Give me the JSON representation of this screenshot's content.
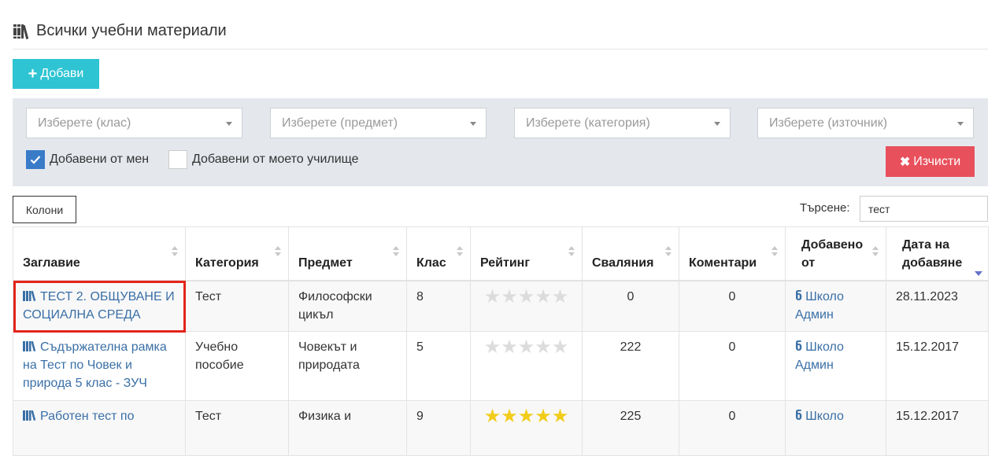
{
  "page": {
    "title": "Всички учебни материали",
    "add_label": "Добави"
  },
  "filters": {
    "class_placeholder": "Изберете (клас)",
    "subject_placeholder": "Изберете (предмет)",
    "category_placeholder": "Изберете (категория)",
    "source_placeholder": "Изберете (източник)",
    "added_by_me_label": "Добавени от мен",
    "added_by_me_checked": true,
    "added_by_school_label": "Добавени от моето училище",
    "added_by_school_checked": false,
    "clear_label": "Изчисти"
  },
  "toolbar": {
    "columns_label": "Колони",
    "search_label": "Търсене:",
    "search_value": "тест"
  },
  "table": {
    "headers": {
      "title": "Заглавие",
      "category": "Категория",
      "subject": "Предмет",
      "grade": "Клас",
      "rating": "Рейтинг",
      "downloads": "Сваляния",
      "comments": "Коментари",
      "added_by": "Добавено от",
      "date_added": "Дата на добавяне"
    },
    "rows": [
      {
        "title": "ТЕСТ 2. ОБЩУВАНЕ И СОЦИАЛНА СРЕДА",
        "category": "Тест",
        "subject": "Философски цикъл",
        "grade": "8",
        "rating": 0,
        "downloads": "0",
        "comments": "0",
        "added_by": "Школо Админ",
        "date_added": "28.11.2023"
      },
      {
        "title": "Съдържателна рамка на Тест по Човек и природа 5 клас - ЗУЧ",
        "category": "Учебно пособие",
        "subject": "Човекът и природата",
        "grade": "5",
        "rating": 0,
        "downloads": "222",
        "comments": "0",
        "added_by": "Школо Админ",
        "date_added": "15.12.2017"
      },
      {
        "title": "Работен тест по",
        "category": "Тест",
        "subject": "Физика и",
        "grade": "9",
        "rating": 5,
        "downloads": "225",
        "comments": "0",
        "added_by": "Школо",
        "date_added": "15.12.2017"
      }
    ]
  },
  "colors": {
    "accent": "#2ec4d3",
    "danger": "#e8505b",
    "link": "#3a6fa6",
    "checkbox": "#3a7bc8",
    "star_on": "#f2cc1a",
    "star_off": "#dcdcdc",
    "highlight": "#e3241b"
  },
  "icons": [
    "books-icon",
    "plus-icon",
    "check-icon",
    "times-icon",
    "star-icon",
    "user-icon"
  ]
}
